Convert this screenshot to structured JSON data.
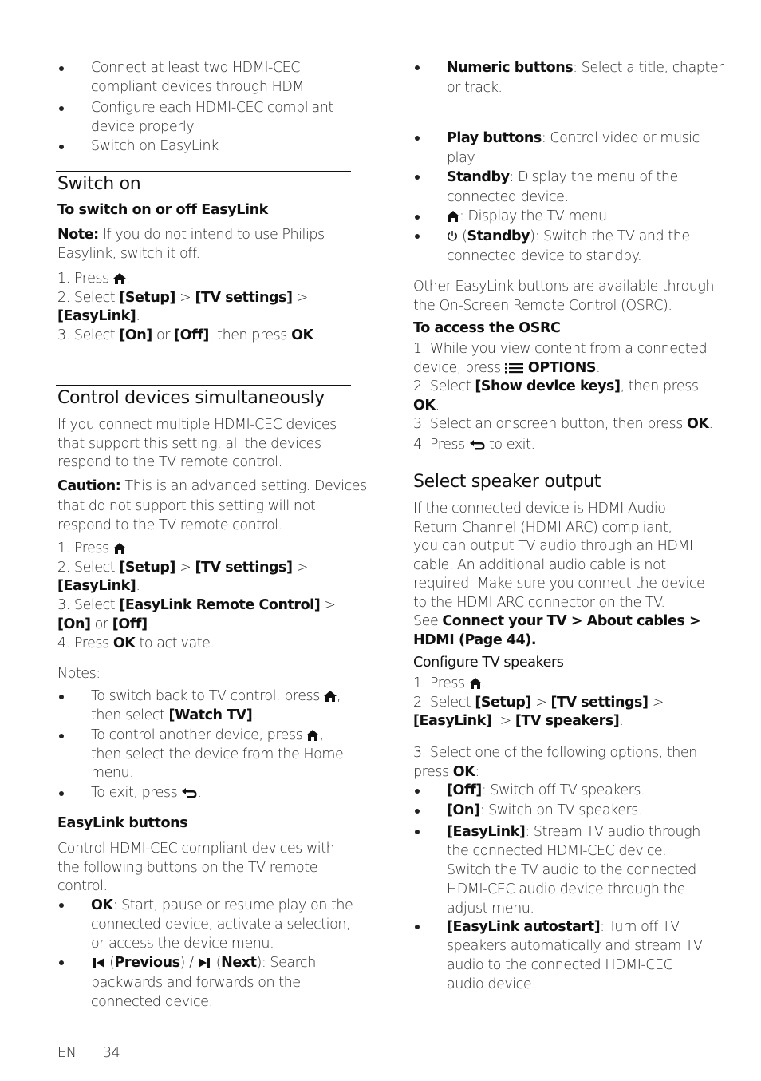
{
  "left": {
    "intro_bullets": [
      [
        "Connect at least two HDMI-CEC",
        "compliant devices through HDMI"
      ],
      [
        "Configure each HDMI-CEC compliant",
        "device properly"
      ],
      [
        "Switch on EasyLink"
      ]
    ],
    "switch_on": {
      "title": "Switch on",
      "subtitle": "To switch on or off EasyLink",
      "note_label": "Note:",
      "note_line1": " If you do not intend to use Philips",
      "note_line2": "Easylink, switch it off.",
      "step1_prefix": "1. Press ",
      "step1_suffix": ".",
      "step2_prefix": "2. Select ",
      "step2_setup": "[Setup]",
      "step2_sep1": " > ",
      "step2_tv": "[TV settings]",
      "step2_sep2": " >",
      "step2_easylink": "[EasyLink]",
      "step2_end": ".",
      "step3_prefix": "3. Select ",
      "step3_on": "[On]",
      "step3_or": " or ",
      "step3_off": "[Off]",
      "step3_mid": ", then press ",
      "step3_ok": "OK",
      "step3_end": "."
    },
    "control": {
      "title": "Control devices simultaneously",
      "para": [
        "If you connect multiple HDMI-CEC devices",
        "that support this setting, all the devices",
        "respond to the TV remote control."
      ],
      "caution_label": "Caution:",
      "caution_line1": " This is an advanced setting. Devices",
      "caution_line2": "that do not support this setting will not",
      "caution_line3": "respond to the TV remote control.",
      "step1_prefix": "1. Press ",
      "step1_suffix": ".",
      "step2_prefix": "2. Select ",
      "step2_setup": "[Setup]",
      "step2_sep1": " > ",
      "step2_tv": "[TV settings]",
      "step2_sep2": " >",
      "step2_easylink": "[EasyLink]",
      "step2_end": ".",
      "step3_prefix": "3. Select ",
      "step3_remote": "[EasyLink Remote Control]",
      "step3_sep": " >",
      "step3_on": "[On]",
      "step3_or": " or ",
      "step3_off": "[Off]",
      "step3_end": ".",
      "step4_prefix": "4. Press ",
      "step4_ok": "OK",
      "step4_suffix": " to activate.",
      "notes_label": "Notes:",
      "note1_a": "To switch back to TV control, press ",
      "note1_a_end": ",",
      "note1_b_prefix": "then select ",
      "note1_b_bold": "[Watch TV]",
      "note1_b_end": ".",
      "note2_a": "To control another device, press ",
      "note2_a_end": ",",
      "note2_b": "then select the device from the Home",
      "note2_c": "menu.",
      "note3_prefix": "To exit, press ",
      "note3_end": "."
    },
    "easylink_buttons": {
      "title": "EasyLink buttons",
      "para": [
        "Control HDMI-CEC compliant devices with",
        "the following buttons on the TV remote",
        "control."
      ],
      "ok_label": "OK",
      "ok_line1": ": Start, pause or resume play on the",
      "ok_line2": "connected device, activate a selection,",
      "ok_line3": "or access the device menu.",
      "prev_label": "Previous",
      "next_label": "Next",
      "prevnext_tail": "): Search",
      "prevnext_line2": "backwards and forwards on the",
      "prevnext_line3": "connected device."
    }
  },
  "right": {
    "buttons": {
      "numeric_label": "Numeric buttons",
      "numeric_line1": ": Select a title, chapter",
      "numeric_line2": "or track.",
      "play_label": "Play buttons",
      "play_line1": ": Control video or music",
      "play_line2": "play.",
      "standby_label": "Standby",
      "standby_line1": ": Display the menu of the",
      "standby_line2": "connected device.",
      "home_text": ": Display the TV menu.",
      "power_label": "Standby",
      "power_line1": "): Switch the TV and the",
      "power_line2": "connected device to standby."
    },
    "osrc": {
      "para": [
        "Other EasyLink buttons are available through",
        "the On-Screen Remote Control (OSRC)."
      ],
      "title": "To access the OSRC",
      "step1_line1": "1. While you view content from a connected",
      "step1_line2_prefix": "device, press ",
      "step1_options": "OPTIONS",
      "step1_end": ".",
      "step2_prefix": "2. Select ",
      "step2_bold": "[Show device keys]",
      "step2_suffix": ", then press",
      "step2_ok": "OK",
      "step2_end": ".",
      "step3_prefix": "3. Select an onscreen button, then press ",
      "step3_ok": "OK",
      "step3_end": ".",
      "step4_prefix": "4. Press ",
      "step4_suffix": " to exit."
    },
    "speaker": {
      "title": "Select speaker output",
      "para": [
        "If the connected device is HDMI Audio",
        "Return Channel (HDMI ARC) compliant,",
        "you can output TV audio through an HDMI",
        "cable. An additional audio cable is not",
        "required. Make sure you connect the device",
        "to the HDMI ARC connector on the TV."
      ],
      "see_prefix": "See ",
      "see_link1": "Connect your TV > About cables >",
      "see_link2": "HDMI (Page 44).",
      "configure_title": "Configure TV speakers",
      "step1_prefix": "1. Press ",
      "step1_suffix": ".",
      "step2_prefix": "2. Select ",
      "step2_setup": "[Setup]",
      "step2_sep1": " > ",
      "step2_tv": "[TV settings]",
      "step2_sep2": " >",
      "step2_easylink": "[EasyLink]",
      "step2_sep3": "  > ",
      "step2_speakers": "[TV speakers]",
      "step2_end": ".",
      "step3_line1": "3. Select one of the following options, then",
      "step3_prefix": "press ",
      "step3_ok": "OK",
      "step3_end": ":",
      "opt_off_label": "[Off]",
      "opt_off_text": ": Switch off TV speakers.",
      "opt_on_label": "[On]",
      "opt_on_text": ": Switch on TV speakers.",
      "opt_easylink_label": "[EasyLink]",
      "opt_easylink_lines": [
        ": Stream TV audio through",
        "the connected HDMI-CEC device.",
        "Switch the TV audio to the connected",
        "HDMI-CEC audio device through the",
        "adjust menu."
      ],
      "opt_autostart_label": "[EasyLink autostart]",
      "opt_autostart_lines": [
        ": Turn off TV",
        "speakers automatically and stream TV",
        "audio to the connected HDMI-CEC",
        "audio device."
      ]
    }
  },
  "footer": {
    "lang": "EN",
    "page": "34"
  }
}
